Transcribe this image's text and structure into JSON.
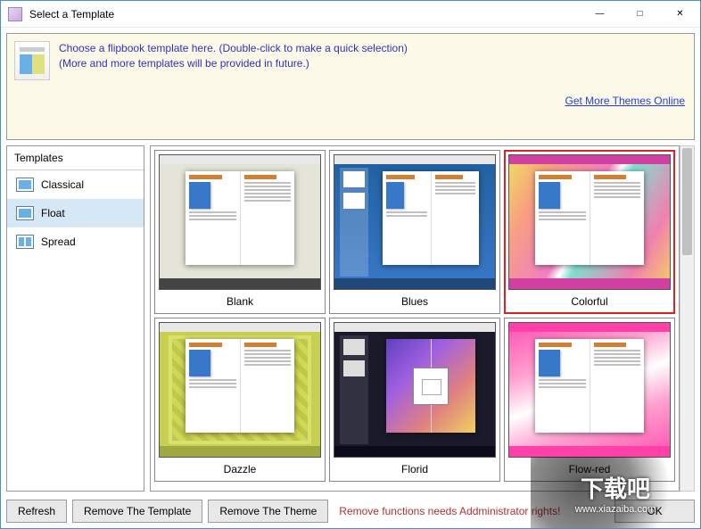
{
  "window": {
    "title": "Select a Template"
  },
  "info": {
    "line1": "Choose a flipbook template here. (Double-click to make a quick selection)",
    "line2": "(More and more templates will be provided in future.)",
    "link": "Get More Themes Online"
  },
  "sidebar": {
    "title": "Templates",
    "items": [
      {
        "label": "Classical"
      },
      {
        "label": "Float"
      },
      {
        "label": "Spread"
      }
    ]
  },
  "templates": [
    {
      "name": "Blank"
    },
    {
      "name": "Blues"
    },
    {
      "name": "Colorful"
    },
    {
      "name": "Dazzle"
    },
    {
      "name": "Florid"
    },
    {
      "name": "Flow-red"
    }
  ],
  "selected_template_index": 2,
  "selected_category_index": 1,
  "footer": {
    "refresh": "Refresh",
    "remove_template": "Remove The Template",
    "remove_theme": "Remove The Theme",
    "warning": "Remove functions needs Addministrator rights!",
    "ok": "OK"
  },
  "watermark": {
    "text_main": "下载吧",
    "text_sub": "www.xiazaiba.com"
  }
}
